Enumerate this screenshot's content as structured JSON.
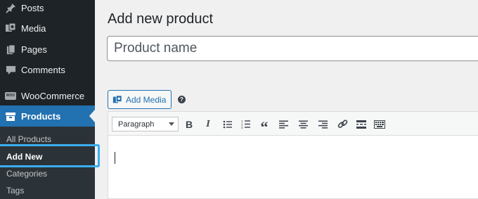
{
  "sidebar": {
    "items": [
      {
        "label": "Posts",
        "icon": "pin-icon"
      },
      {
        "label": "Media",
        "icon": "media-icon"
      },
      {
        "label": "Pages",
        "icon": "pages-icon"
      },
      {
        "label": "Comments",
        "icon": "comment-icon"
      },
      {
        "label": "WooCommerce",
        "icon": "woocommerce-icon"
      },
      {
        "label": "Products",
        "icon": "products-icon"
      }
    ],
    "submenu": [
      "All Products",
      "Add New",
      "Categories",
      "Tags"
    ],
    "active_item": "Products",
    "current_subitem": "Add New",
    "woo_badge": "WOO"
  },
  "main": {
    "title": "Add new product",
    "title_placeholder": "Product name",
    "add_media_label": "Add Media",
    "help_icon_text": "?"
  },
  "editor": {
    "format_selected": "Paragraph",
    "toolbar_icons": [
      "bold-icon",
      "italic-icon",
      "bulleted-list-icon",
      "numbered-list-icon",
      "blockquote-icon",
      "align-left-icon",
      "align-center-icon",
      "align-right-icon",
      "link-icon",
      "read-more-icon",
      "toolbar-toggle-icon"
    ],
    "bold_glyph": "B",
    "italic_glyph": "I",
    "quote_glyph": "“"
  },
  "colors": {
    "sidebar_bg": "#1d2327",
    "submenu_bg": "#2c3338",
    "active_blue": "#2271b1",
    "highlight": "#3aaef0"
  }
}
